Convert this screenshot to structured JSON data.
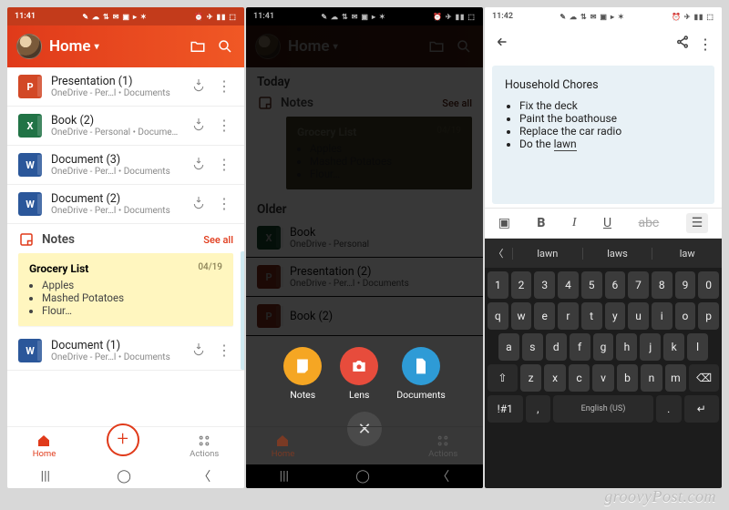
{
  "status": {
    "time_a": "11:41",
    "time_b": "11:41",
    "time_c": "11:42",
    "icons": "✎ ☁ ⇅ ✉ ▣ ▸ ✶",
    "right": "⏰ ✈ ▮▮ ⬚"
  },
  "p1": {
    "title": "Home",
    "files": [
      {
        "icon": "pp",
        "letter": "P",
        "name": "Presentation (1)",
        "sub": "OneDrive - Per…l • Documents"
      },
      {
        "icon": "xl",
        "letter": "X",
        "name": "Book (2)",
        "sub": "OneDrive - Personal • Documents"
      },
      {
        "icon": "wd",
        "letter": "W",
        "name": "Document (3)",
        "sub": "OneDrive - Per…l • Documents"
      },
      {
        "icon": "wd",
        "letter": "W",
        "name": "Document (2)",
        "sub": "OneDrive - Per…l • Documents"
      }
    ],
    "notes_label": "Notes",
    "see_all": "See all",
    "note": {
      "title": "Grocery List",
      "date": "04/19",
      "items": [
        "Apples",
        "Mashed Potatoes",
        "Flour…"
      ]
    },
    "last": {
      "name": "Document (1)",
      "sub": "OneDrive - Per…l • Documents"
    },
    "tab_home": "Home",
    "tab_actions": "Actions"
  },
  "p2": {
    "today": "Today",
    "older": "Older",
    "notes_label": "Notes",
    "see_all": "See all",
    "note": {
      "title": "Grocery List",
      "date": "04/19",
      "items": [
        "Apples",
        "Mashed Potatoes",
        "Flour…"
      ]
    },
    "under_files": [
      {
        "name": "Book",
        "sub": "OneDrive - Personal"
      },
      {
        "name": "Presentation (2)",
        "sub": "OneDrive - Per…l • Documents"
      },
      {
        "name": "Book (2)",
        "sub": ""
      }
    ],
    "fab": {
      "notes": "Notes",
      "lens": "Lens",
      "docs": "Documents"
    },
    "tab_home": "Home",
    "tab_actions": "Actions"
  },
  "p3": {
    "title": "Household Chores",
    "items": [
      "Fix the deck",
      "Paint the boathouse",
      "Replace the car radio"
    ],
    "last_item_pre": "Do the ",
    "last_item_word": "lawn",
    "tool_abc": "abc",
    "sugg": [
      "lawn",
      "laws",
      "law"
    ],
    "rows": {
      "r1": [
        "1",
        "2",
        "3",
        "4",
        "5",
        "6",
        "7",
        "8",
        "9",
        "0"
      ],
      "r2": [
        "q",
        "w",
        "e",
        "r",
        "t",
        "y",
        "u",
        "i",
        "o",
        "p"
      ],
      "r3": [
        "a",
        "s",
        "d",
        "f",
        "g",
        "h",
        "j",
        "k",
        "l"
      ],
      "r4_mid": [
        "z",
        "x",
        "c",
        "v",
        "b",
        "n",
        "m"
      ],
      "shift": "⇧",
      "bksp": "⌫",
      "sym": "!#1",
      "comma": ",",
      "space": "English (US)",
      "period": ".",
      "enter": "↵"
    }
  },
  "brand": "groovyPost.com"
}
